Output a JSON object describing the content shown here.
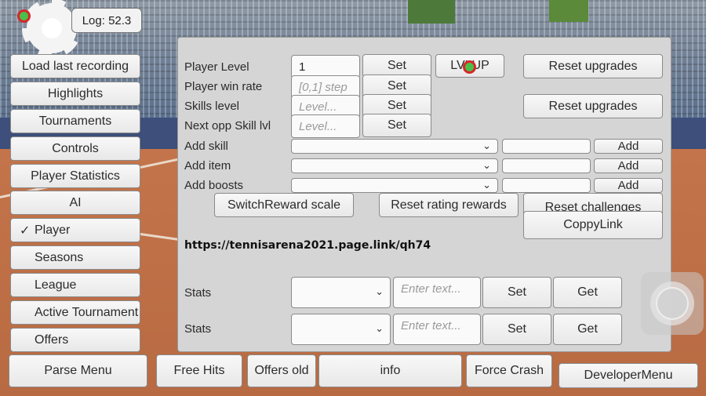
{
  "log": {
    "text": "Log: 52.3"
  },
  "sidebar": {
    "items": [
      {
        "label": "Load last recording"
      },
      {
        "label": "Highlights"
      },
      {
        "label": "Tournaments"
      },
      {
        "label": "Controls"
      },
      {
        "label": "Player Statistics"
      },
      {
        "label": "AI"
      },
      {
        "label": "Player",
        "checked": "✓"
      },
      {
        "label": "Seasons"
      },
      {
        "label": "League"
      },
      {
        "label": "Active Tournament"
      },
      {
        "label": "Offers"
      }
    ]
  },
  "panel": {
    "player_level": {
      "label": "Player Level",
      "value": "1",
      "set": "Set"
    },
    "win_rate": {
      "label": "Player win rate",
      "placeholder": "[0,1] step",
      "set": "Set"
    },
    "skills_level": {
      "label": "Skills level",
      "placeholder": "Level...",
      "set": "Set"
    },
    "next_opp": {
      "label": "Next opp Skill lvl",
      "placeholder": "Level...",
      "set": "Set"
    },
    "lvlup": "LVLUP",
    "reset_upgrades_1": "Reset upgrades",
    "reset_upgrades_2": "Reset upgrades",
    "add_skill": {
      "label": "Add skill",
      "add": "Add"
    },
    "add_item": {
      "label": "Add item",
      "add": "Add"
    },
    "add_boosts": {
      "label": "Add boosts",
      "add": "Add"
    },
    "switch_reward": "SwitchReward scale",
    "reset_rating": "Reset rating rewards",
    "reset_challenges": "Reset challenges",
    "copy_link": "CoppyLink",
    "link": "https://tennisarena2021.page.link/qh74",
    "stats_rows": [
      {
        "label": "Stats",
        "placeholder": "Enter text...",
        "set": "Set",
        "get": "Get"
      },
      {
        "label": "Stats",
        "placeholder": "Enter text...",
        "set": "Set",
        "get": "Get"
      }
    ]
  },
  "bottom_bar": {
    "parse_menu": "Parse Menu",
    "free_hits": "Free Hits",
    "offers_old": "Offers old",
    "info": "info",
    "force_crash": "Force Crash",
    "developer_menu": "DeveloperMenu"
  },
  "icons": {
    "gear": "gear-icon",
    "recording": "recording-indicator-icon",
    "chevron": "chevron-down-icon",
    "check": "checkmark-icon",
    "joystick": "joystick-icon"
  },
  "colors": {
    "panel_bg": "#d5d5d5",
    "indicator_red": "#d8262a",
    "indicator_green": "#49c04a"
  }
}
